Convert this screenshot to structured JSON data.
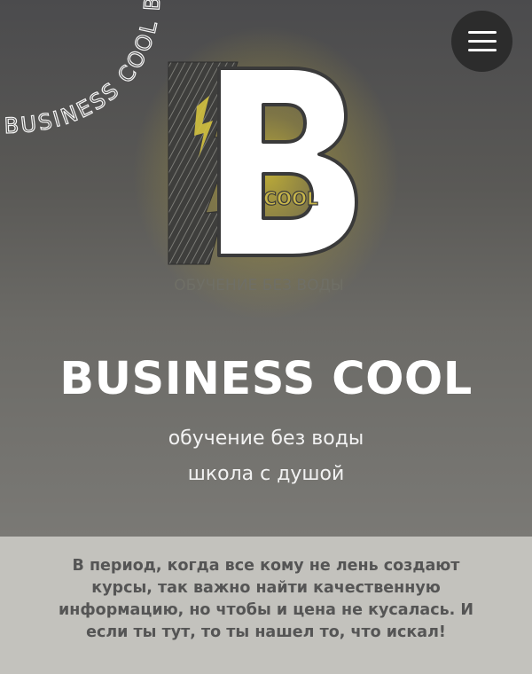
{
  "header": {
    "menu_button_icon": "hamburger-menu-icon"
  },
  "logo": {
    "arc_text": "BUSINESS COOL BUSINESS",
    "letter": "B",
    "cool_label": "COOL",
    "slogan": "ОБУЧЕНИЕ БЕЗ ВОДЫ",
    "glow_color": "#c9b53a"
  },
  "hero": {
    "title": "BUSINESS COOL",
    "tagline_1": "обучение без воды",
    "tagline_2": "школа с душой"
  },
  "intro": {
    "text": "В период, когда все кому не лень создают курсы, так важно найти качественную информацию, но чтобы и цена не кусалась. И если ты тут, то ты нашел то, что искал!"
  }
}
